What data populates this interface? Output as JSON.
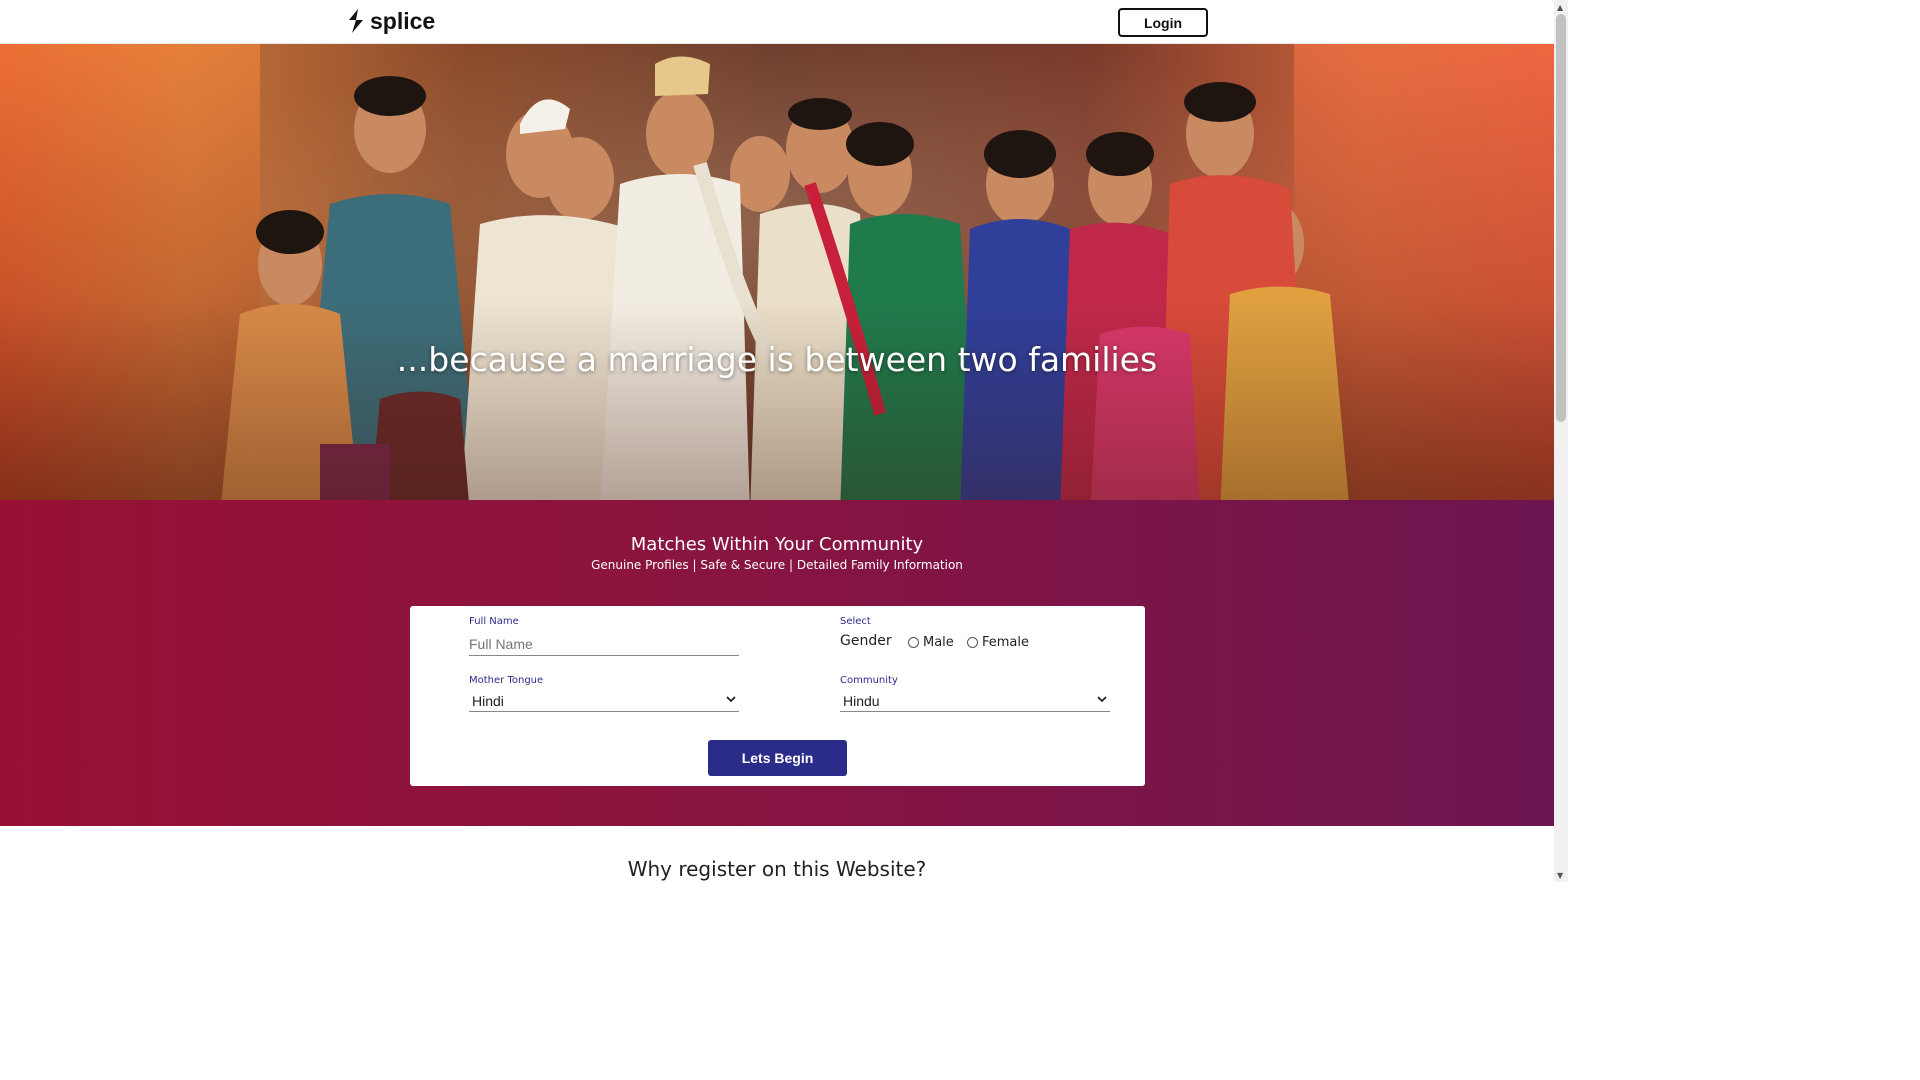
{
  "header": {
    "logo_text": "splice",
    "login_label": "Login"
  },
  "hero": {
    "tagline": "...because a marriage is between two families"
  },
  "registration": {
    "title": "Matches Within Your Community",
    "subtitle": "Genuine Profiles | Safe & Secure | Detailed Family Information",
    "full_name": {
      "label": "Full Name",
      "placeholder": "Full Name",
      "value": ""
    },
    "gender": {
      "label": "Select",
      "text": "Gender",
      "options": [
        "Male",
        "Female"
      ]
    },
    "mother_tongue": {
      "label": "Mother Tongue",
      "value": "Hindi"
    },
    "community": {
      "label": "Community",
      "value": "Hindu"
    },
    "submit_label": "Lets Begin"
  },
  "why_heading": "Why register on this Website?",
  "colors": {
    "band_start": "#981135",
    "band_end": "#6c1550",
    "button": "#2b2c8a"
  }
}
